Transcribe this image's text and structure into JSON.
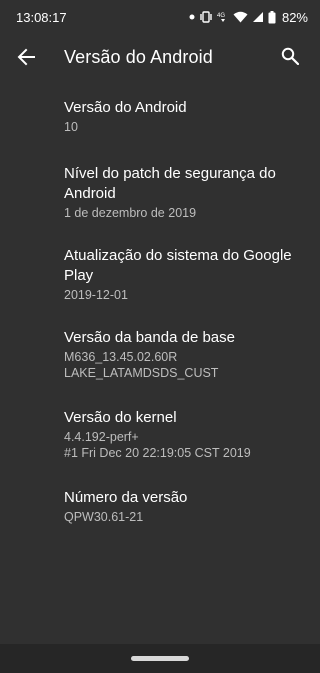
{
  "status_bar": {
    "time": "13:08:17",
    "network_label": "4G",
    "battery": "82%",
    "icons": [
      "notification-dot-icon",
      "vibrate-icon",
      "lte-signal-icon",
      "wifi-icon",
      "cell-signal-icon",
      "battery-icon"
    ]
  },
  "toolbar": {
    "title": "Versão do Android",
    "back_icon": "arrow-back-icon",
    "search_icon": "search-icon"
  },
  "items": [
    {
      "title": "Versão do Android",
      "summary": "10"
    },
    {
      "title": "Nível do patch de segurança do\nAndroid",
      "summary": "1 de dezembro de 2019"
    },
    {
      "title": "Atualização do sistema do Google\nPlay",
      "summary": "2019-12-01"
    },
    {
      "title": "Versão da banda de base",
      "summary": "M636_13.45.02.60R\nLAKE_LATAMDSDS_CUST"
    },
    {
      "title": "Versão do kernel",
      "summary": "4.4.192-perf+\n#1 Fri Dec 20 22:19:05 CST 2019"
    },
    {
      "title": "Número da versão",
      "summary": "QPW30.61-21"
    }
  ],
  "colors": {
    "background": "#303030",
    "text_primary": "#ffffff",
    "text_secondary": "#bdbdbd",
    "nav_bar": "#262626"
  }
}
